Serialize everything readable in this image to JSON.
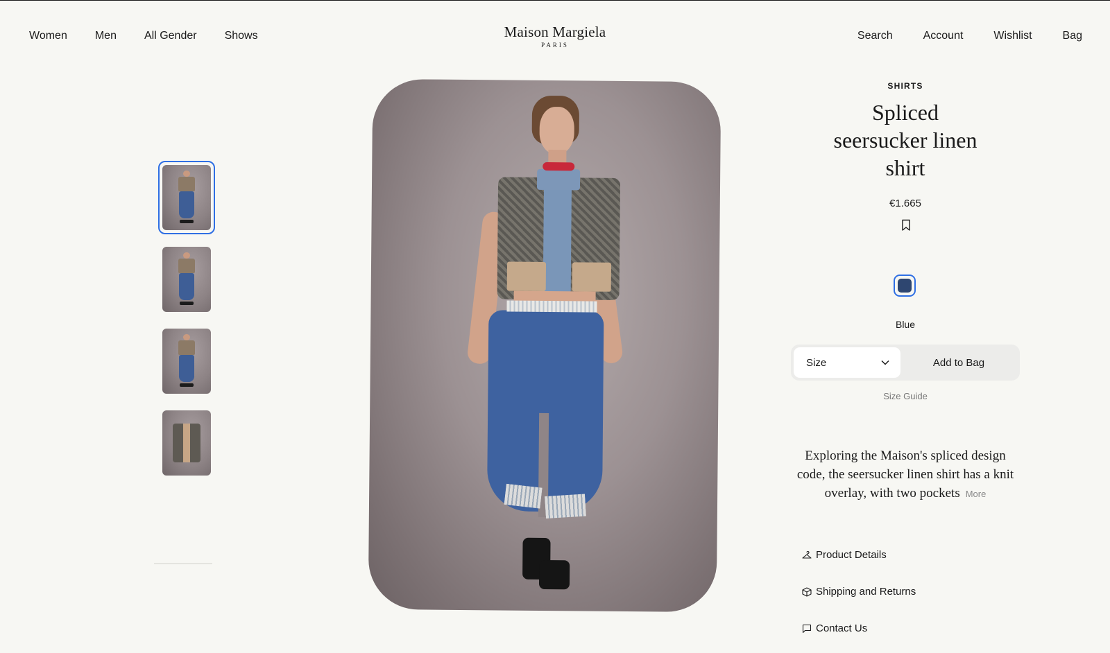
{
  "brand": {
    "name": "Maison Margiela",
    "sub": "PARIS"
  },
  "nav_left": [
    "Women",
    "Men",
    "All Gender",
    "Shows"
  ],
  "nav_right": [
    "Search",
    "Account",
    "Wishlist",
    "Bag"
  ],
  "thumbnails": [
    "front-view",
    "side-view",
    "side-walk-view",
    "flat-lay-view"
  ],
  "product": {
    "category": "SHIRTS",
    "title": "Spliced seersucker linen shirt",
    "price": "€1.665",
    "color": {
      "name": "Blue",
      "hex": "#2e4670"
    },
    "size_label": "Size",
    "add_to_bag": "Add to Bag",
    "size_guide": "Size Guide",
    "description": "Exploring the Maison's spliced design code, the seersucker linen shirt has a knit overlay, with two pockets",
    "more": "More"
  },
  "accordions": [
    "Product Details",
    "Shipping and Returns",
    "Contact Us"
  ],
  "colors": {
    "accent": "#2f6fe4",
    "background": "#f7f7f3"
  }
}
